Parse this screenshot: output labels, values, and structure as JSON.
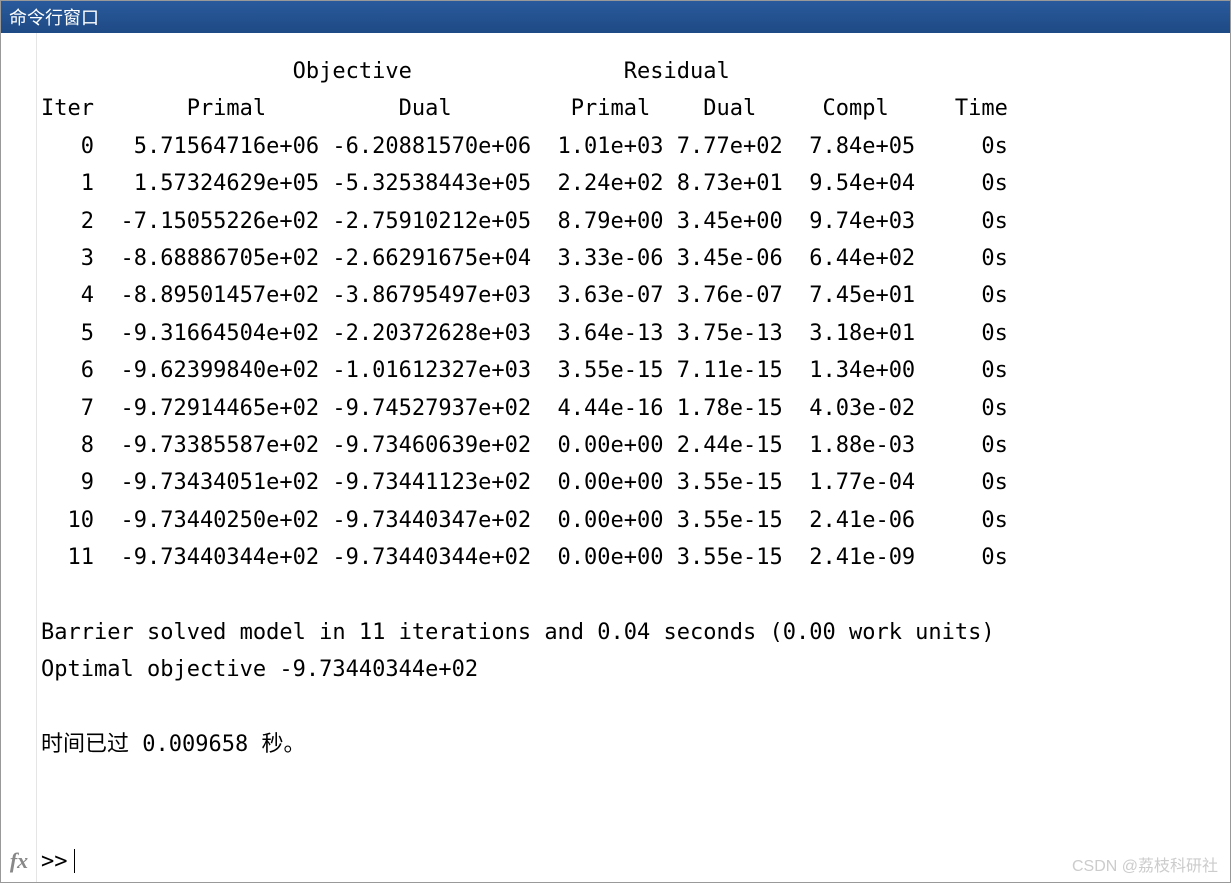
{
  "titlebar": {
    "title": "命令行窗口"
  },
  "output": {
    "header1": "                   Objective                Residual",
    "header2": "Iter       Primal          Dual         Primal    Dual     Compl     Time",
    "rows": [
      "   0   5.71564716e+06 -6.20881570e+06  1.01e+03 7.77e+02  7.84e+05     0s",
      "   1   1.57324629e+05 -5.32538443e+05  2.24e+02 8.73e+01  9.54e+04     0s",
      "   2  -7.15055226e+02 -2.75910212e+05  8.79e+00 3.45e+00  9.74e+03     0s",
      "   3  -8.68886705e+02 -2.66291675e+04  3.33e-06 3.45e-06  6.44e+02     0s",
      "   4  -8.89501457e+02 -3.86795497e+03  3.63e-07 3.76e-07  7.45e+01     0s",
      "   5  -9.31664504e+02 -2.20372628e+03  3.64e-13 3.75e-13  3.18e+01     0s",
      "   6  -9.62399840e+02 -1.01612327e+03  3.55e-15 7.11e-15  1.34e+00     0s",
      "   7  -9.72914465e+02 -9.74527937e+02  4.44e-16 1.78e-15  4.03e-02     0s",
      "   8  -9.73385587e+02 -9.73460639e+02  0.00e+00 2.44e-15  1.88e-03     0s",
      "   9  -9.73434051e+02 -9.73441123e+02  0.00e+00 3.55e-15  1.77e-04     0s",
      "  10  -9.73440250e+02 -9.73440347e+02  0.00e+00 3.55e-15  2.41e-06     0s",
      "  11  -9.73440344e+02 -9.73440344e+02  0.00e+00 3.55e-15  2.41e-09     0s"
    ],
    "summary1": "Barrier solved model in 11 iterations and 0.04 seconds (0.00 work units)",
    "summary2": "Optimal objective -9.73440344e+02",
    "elapsed": "时间已过 0.009658 秒。"
  },
  "prompt": {
    "fx": "fx",
    "symbol": ">> "
  },
  "watermark": "CSDN @荔枝科研社"
}
